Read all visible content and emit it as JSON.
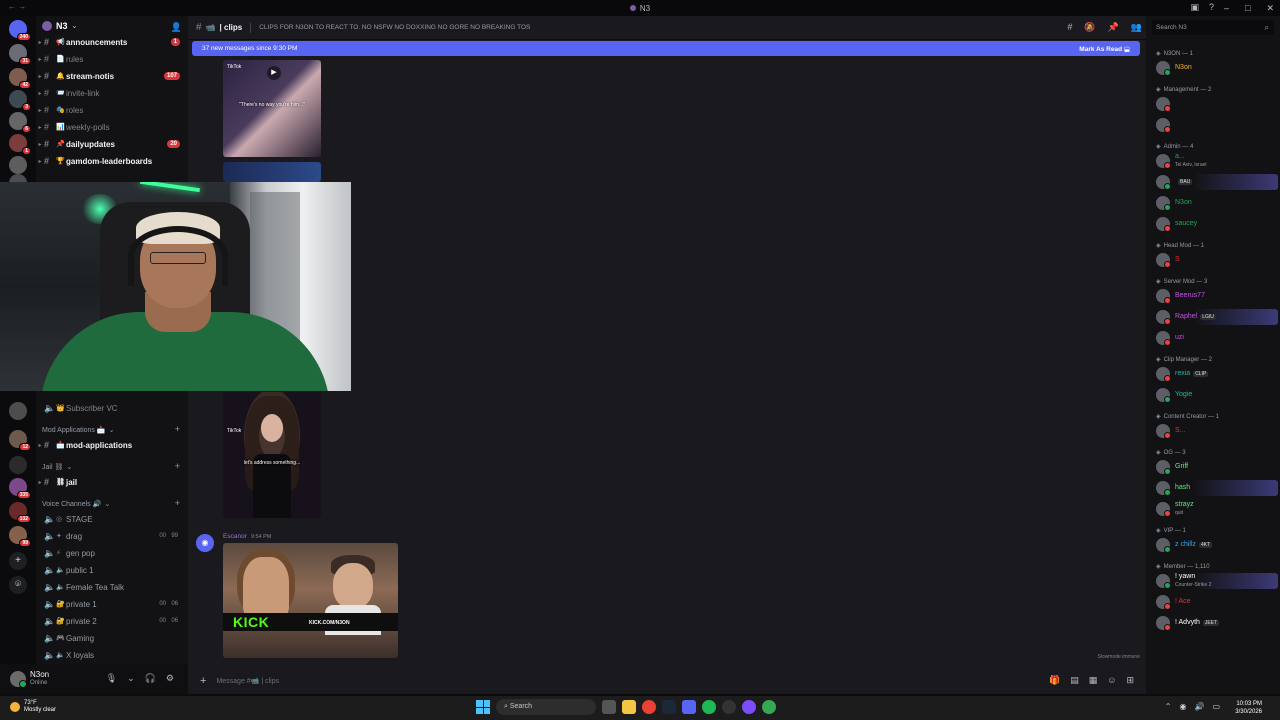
{
  "window": {
    "title": "N3",
    "back_arrows": "← →"
  },
  "guilds": {
    "items": [
      {
        "badge": "240",
        "color": "#5865f2"
      },
      {
        "badge": "31",
        "color": "#6a6d75"
      },
      {
        "badge": "42",
        "color": "#7e5c50"
      },
      {
        "badge": "3",
        "color": "#3d4a52"
      },
      {
        "badge": "6",
        "color": "#666666"
      },
      {
        "badge": "1",
        "color": "#7b3c3c"
      },
      {
        "badge": "",
        "color": "#5d5d5d"
      },
      {
        "badge": "",
        "color": "#4c4c55"
      }
    ],
    "lower": [
      {
        "badge": "",
        "color": "#4d4d4d"
      },
      {
        "badge": "12",
        "color": "#6d5a4c"
      },
      {
        "badge": "",
        "color": "#2b2b2b"
      },
      {
        "badge": "335",
        "color": "#7a4a8a"
      },
      {
        "badge": "132",
        "color": "#6b2a2a"
      },
      {
        "badge": "99",
        "color": "#85604a"
      }
    ]
  },
  "sidebar": {
    "server_name": "N3",
    "top_channels": [
      {
        "name": "announcements",
        "emoji": "📢",
        "unread": true,
        "pill": "1"
      },
      {
        "name": "rules",
        "emoji": "📄",
        "unread": false,
        "pill": ""
      },
      {
        "name": "stream-notis",
        "emoji": "🔔",
        "unread": true,
        "pill": "107"
      },
      {
        "name": "invite-link",
        "emoji": "📨",
        "unread": false,
        "pill": ""
      },
      {
        "name": "roles",
        "emoji": "🎭",
        "unread": false,
        "pill": ""
      },
      {
        "name": "weekly-polls",
        "emoji": "📊",
        "unread": false,
        "pill": ""
      },
      {
        "name": "dailyupdates",
        "emoji": "📌",
        "unread": true,
        "pill": "20"
      },
      {
        "name": "gamdom-leaderboards",
        "emoji": "🏆",
        "unread": true,
        "pill": ""
      }
    ],
    "subscriber_vc": "Subscriber VC",
    "mod_category": "Mod Applications 📩",
    "mod_channel": "mod-applications",
    "jail_category": "Jail ⛓",
    "jail_channel": "jail",
    "voice_category": "Voice Channels 🔊",
    "voice_channels": [
      {
        "name": "STAGE",
        "icon": "◎",
        "count_a": "",
        "count_b": ""
      },
      {
        "name": "drag",
        "icon": "✦",
        "count_a": "00",
        "count_b": "99"
      },
      {
        "name": "gen pop",
        "icon": "⚡",
        "count_a": "",
        "count_b": ""
      },
      {
        "name": "public 1",
        "icon": "🔈",
        "count_a": "",
        "count_b": ""
      },
      {
        "name": "Female Tea Talk",
        "icon": "🔈",
        "count_a": "",
        "count_b": ""
      },
      {
        "name": "private 1",
        "icon": "🔐",
        "count_a": "00",
        "count_b": "06"
      },
      {
        "name": "private 2",
        "icon": "🔐",
        "count_a": "00",
        "count_b": "06"
      },
      {
        "name": "Gaming",
        "icon": "🎮",
        "count_a": "",
        "count_b": ""
      },
      {
        "name": "X loyals",
        "icon": "🔈",
        "count_a": "",
        "count_b": ""
      }
    ],
    "user": {
      "name": "N3on",
      "status": "Online"
    }
  },
  "chat": {
    "channel": "| clips",
    "topic": "CLIPS FOR N3ON TO REACT TO. NO NSFW NO DOXXING NO GORE NO BREAKING TOS",
    "new_messages": "37 new messages since 9:30 PM",
    "mark_as_read": "Mark As Read",
    "media1_caption": "\"There's no way you're him...\"",
    "media2_caption": "let's address something...",
    "tiktok_label": "TikTok",
    "message_author": "Escanor",
    "message_time": "9:54 PM",
    "kick_logo": "KICK",
    "kick_url": "KICK.COM/N3ON",
    "slowmode": "Slowmode immune",
    "composer_placeholder": "Message #📹 | clips"
  },
  "members": {
    "search_placeholder": "Search N3",
    "groups": [
      {
        "header": "N3ON — 1",
        "members": [
          {
            "name": "N3on",
            "color": "#f0b232",
            "sub": "",
            "tag": "",
            "online": true
          }
        ]
      },
      {
        "header": "Management — 2",
        "members": [
          {
            "name": "",
            "color": "#2b2d8a",
            "sub": "",
            "tag": "",
            "online": false
          },
          {
            "name": "",
            "color": "#2b2d8a",
            "sub": "",
            "tag": "",
            "online": false
          }
        ]
      },
      {
        "header": "Admin — 4",
        "members": [
          {
            "name": "a...",
            "color": "#23a55a",
            "sub": "Tel Aviv, Israel",
            "tag": "",
            "online": false
          },
          {
            "name": "",
            "color": "#23a55a",
            "sub": "",
            "tag": "BAU",
            "online": true,
            "hl": true
          },
          {
            "name": "N3on",
            "color": "#23a55a",
            "sub": "",
            "tag": "",
            "online": true
          },
          {
            "name": "saucey",
            "color": "#23a55a",
            "sub": "",
            "tag": "",
            "online": false
          }
        ]
      },
      {
        "header": "Head Mod — 1",
        "members": [
          {
            "name": "S",
            "color": "#da373c",
            "sub": "",
            "tag": "",
            "online": false
          }
        ]
      },
      {
        "header": "Server Mod — 3",
        "members": [
          {
            "name": "Beerus77",
            "color": "#c154e0",
            "sub": "",
            "tag": "",
            "online": false
          },
          {
            "name": "Raphel",
            "color": "#c154e0",
            "sub": "",
            "tag": "LGIU",
            "online": false,
            "hl": true
          },
          {
            "name": "uzi",
            "color": "#c154e0",
            "sub": "",
            "tag": "",
            "online": false
          }
        ]
      },
      {
        "header": "Clip Manager — 2",
        "members": [
          {
            "name": "rexia",
            "color": "#1abc9c",
            "sub": "",
            "tag": "CLIP",
            "online": false
          },
          {
            "name": "Yogie",
            "color": "#1abc9c",
            "sub": "",
            "tag": "",
            "online": true
          }
        ]
      },
      {
        "header": "Content Creator — 1",
        "members": [
          {
            "name": "S...",
            "color": "#da373c",
            "sub": "",
            "tag": "",
            "online": false
          }
        ]
      },
      {
        "header": "OG — 3",
        "members": [
          {
            "name": "Griff",
            "color": "#57f287",
            "sub": "",
            "tag": "",
            "online": true
          },
          {
            "name": "hash",
            "color": "#57f287",
            "sub": "",
            "tag": "",
            "online": true,
            "hl": true
          },
          {
            "name": "strayz",
            "color": "#57f287",
            "sub": "quit",
            "tag": "",
            "online": false
          }
        ]
      },
      {
        "header": "VIP — 1",
        "members": [
          {
            "name": "z chillz",
            "color": "#3ba5f2",
            "sub": "",
            "tag": "4KT",
            "online": true
          }
        ]
      },
      {
        "header": "Member — 1,110",
        "members": [
          {
            "name": "! yawn",
            "color": "#ffffff",
            "sub": "Counter-Strike 2",
            "tag": "",
            "online": true,
            "hl": true
          },
          {
            "name": "! Ace",
            "color": "#da373c",
            "sub": "",
            "tag": "",
            "online": false
          },
          {
            "name": "! Advyth",
            "color": "#ffffff",
            "sub": "",
            "tag": "JEET",
            "online": false
          }
        ]
      }
    ]
  },
  "taskbar": {
    "temp": "73°F",
    "weather": "Mostly clear",
    "search": "Search",
    "time": "10:03 PM",
    "date": "3/30/2026"
  }
}
